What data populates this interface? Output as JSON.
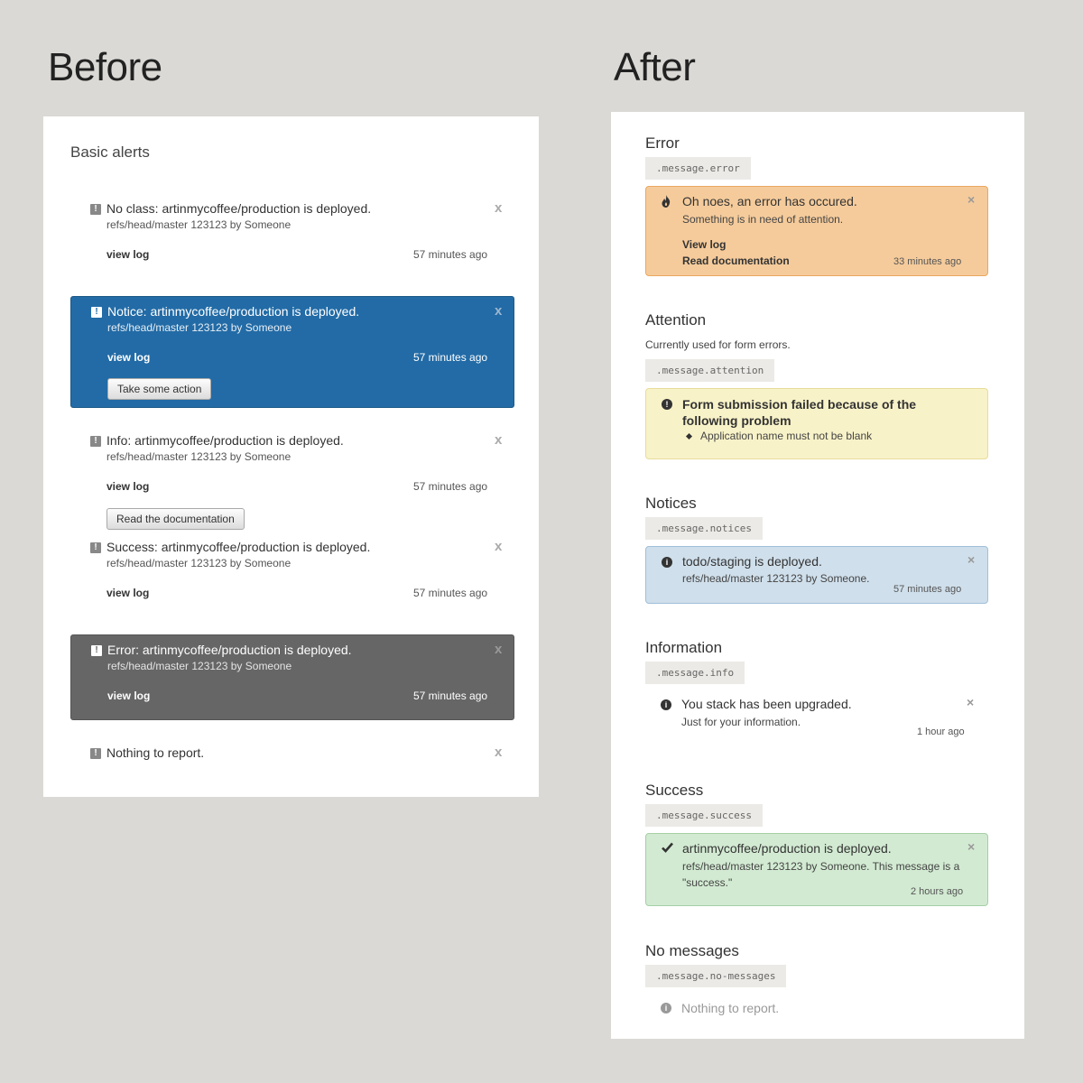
{
  "before": {
    "heading": "Before",
    "panel_title": "Basic alerts",
    "alerts": [
      {
        "title": "No class: artinmycoffee/production is deployed.",
        "sub": "refs/head/master 123123 by Someone",
        "link": "view log",
        "time": "57 minutes ago",
        "close": "x"
      },
      {
        "title": "Notice: artinmycoffee/production is deployed.",
        "sub": "refs/head/master 123123 by Someone",
        "link": "view log",
        "time": "57 minutes ago",
        "close": "x",
        "button": "Take some action"
      },
      {
        "title": "Info: artinmycoffee/production is deployed.",
        "sub": "refs/head/master 123123 by Someone",
        "link": "view log",
        "time": "57 minutes ago",
        "close": "x",
        "button": "Read the documentation"
      },
      {
        "title": "Success: artinmycoffee/production is deployed.",
        "sub": "refs/head/master 123123 by Someone",
        "link": "view log",
        "time": "57 minutes ago",
        "close": "x"
      },
      {
        "title": "Error: artinmycoffee/production is deployed.",
        "sub": "refs/head/master 123123 by Someone",
        "link": "view log",
        "time": "57 minutes ago",
        "close": "x"
      },
      {
        "title": "Nothing to report.",
        "close": "x"
      }
    ],
    "icon_glyph": "!",
    "colors": {
      "notice_bg": "#226ba6",
      "error_bg": "#666666"
    }
  },
  "after": {
    "heading": "After",
    "sections": {
      "error": {
        "label": "Error",
        "code": ".message.error",
        "title": "Oh noes, an error has occured.",
        "sub": "Something is in need of attention.",
        "link1": "View log",
        "link2": "Read documentation",
        "time": "33 minutes ago",
        "icon": "fire-icon",
        "close": "×"
      },
      "attention": {
        "label": "Attention",
        "desc": "Currently used for form errors.",
        "code": ".message.attention",
        "title": "Form submission failed because of the following problem",
        "bullet": "Application name must not be blank",
        "icon": "exclamation-icon"
      },
      "notices": {
        "label": "Notices",
        "code": ".message.notices",
        "title": "todo/staging is deployed.",
        "sub": "refs/head/master 123123 by Someone.",
        "time": "57 minutes ago",
        "icon": "info-icon",
        "close": "×"
      },
      "info": {
        "label": "Information",
        "code": ".message.info",
        "title": "You stack has been upgraded.",
        "sub": "Just for your information.",
        "time": "1 hour ago",
        "icon": "info-icon",
        "close": "×"
      },
      "success": {
        "label": "Success",
        "code": ".message.success",
        "title": "artinmycoffee/production is deployed.",
        "sub": "refs/head/master 123123 by Someone. This message is a \"success.\"",
        "time": "2 hours ago",
        "icon": "checkmark-icon",
        "close": "×"
      },
      "nomsg": {
        "label": "No messages",
        "code": ".message.no-messages",
        "title": "Nothing to report.",
        "icon": "info-icon"
      }
    },
    "colors": {
      "error_bg": "#f5cb9b",
      "attention_bg": "#f8f2c8",
      "notices_bg": "#cfdfeb",
      "success_bg": "#d2ead2"
    }
  }
}
